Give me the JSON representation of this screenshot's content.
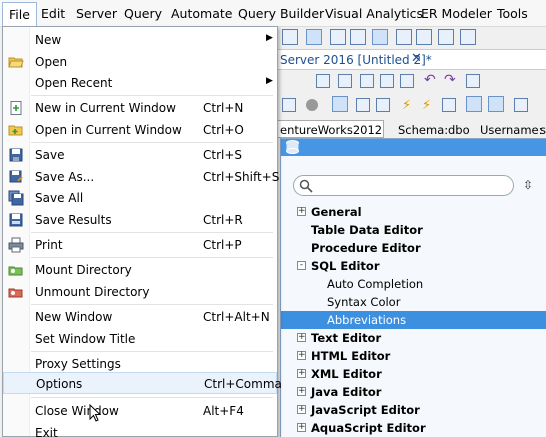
{
  "menubar": {
    "items": [
      "File",
      "Edit",
      "Server",
      "Query",
      "Automate",
      "Query Builder",
      "Visual Analytics",
      "ER Modeler",
      "Tools"
    ]
  },
  "background": {
    "doc_tab_title": "Server 2016 [Untitled 2]*",
    "db_selector": "entureWorks2012",
    "schema_label": "Schema:",
    "schema_value": "dbo",
    "username_label": "Username:",
    "username_value": "sa"
  },
  "file_menu": {
    "items": [
      {
        "label": "New",
        "shortcut": "",
        "submenu": true,
        "icon": "none"
      },
      {
        "label": "Open",
        "shortcut": "",
        "submenu": false,
        "icon": "folder-open-icon"
      },
      {
        "label": "Open Recent",
        "shortcut": "",
        "submenu": true,
        "icon": "none"
      },
      {
        "label": "New in Current Window",
        "shortcut": "Ctrl+N",
        "submenu": false,
        "icon": "new-document-icon"
      },
      {
        "label": "Open in Current Window",
        "shortcut": "Ctrl+O",
        "submenu": false,
        "icon": "open-document-icon"
      },
      {
        "label": "Save",
        "shortcut": "Ctrl+S",
        "submenu": false,
        "icon": "save-icon"
      },
      {
        "label": "Save As...",
        "shortcut": "Ctrl+Shift+S",
        "submenu": false,
        "icon": "save-as-icon"
      },
      {
        "label": "Save All",
        "shortcut": "",
        "submenu": false,
        "icon": "save-all-icon"
      },
      {
        "label": "Save Results",
        "shortcut": "Ctrl+R",
        "submenu": false,
        "icon": "save-results-icon"
      },
      {
        "label": "Print",
        "shortcut": "Ctrl+P",
        "submenu": false,
        "icon": "print-icon"
      },
      {
        "label": "Mount Directory",
        "shortcut": "",
        "submenu": false,
        "icon": "mount-directory-icon"
      },
      {
        "label": "Unmount Directory",
        "shortcut": "",
        "submenu": false,
        "icon": "unmount-directory-icon"
      },
      {
        "label": "New Window",
        "shortcut": "Ctrl+Alt+N",
        "submenu": false,
        "icon": "none"
      },
      {
        "label": "Set Window Title",
        "shortcut": "",
        "submenu": false,
        "icon": "none"
      },
      {
        "label": "Proxy Settings",
        "shortcut": "",
        "submenu": false,
        "icon": "none"
      },
      {
        "label": "Options",
        "shortcut": "Ctrl+Comma",
        "submenu": false,
        "icon": "none",
        "highlighted": true
      },
      {
        "label": "Close Window",
        "shortcut": "Alt+F4",
        "submenu": false,
        "icon": "none"
      },
      {
        "label": "Exit",
        "shortcut": "",
        "submenu": false,
        "icon": "none"
      }
    ]
  },
  "options_panel": {
    "search_placeholder": "",
    "tree": [
      {
        "label": "General",
        "bold": true,
        "toggle": "+",
        "indent": 0
      },
      {
        "label": "Table Data Editor",
        "bold": true,
        "toggle": "",
        "indent": 0
      },
      {
        "label": "Procedure Editor",
        "bold": true,
        "toggle": "",
        "indent": 0
      },
      {
        "label": "SQL Editor",
        "bold": true,
        "toggle": "-",
        "indent": 0
      },
      {
        "label": "Auto Completion",
        "bold": false,
        "toggle": "",
        "indent": 1
      },
      {
        "label": "Syntax Color",
        "bold": false,
        "toggle": "",
        "indent": 1
      },
      {
        "label": "Abbreviations",
        "bold": false,
        "toggle": "",
        "indent": 1,
        "selected": true
      },
      {
        "label": "Text Editor",
        "bold": true,
        "toggle": "+",
        "indent": 0
      },
      {
        "label": "HTML Editor",
        "bold": true,
        "toggle": "+",
        "indent": 0
      },
      {
        "label": "XML Editor",
        "bold": true,
        "toggle": "+",
        "indent": 0
      },
      {
        "label": "Java Editor",
        "bold": true,
        "toggle": "+",
        "indent": 0
      },
      {
        "label": "JavaScript Editor",
        "bold": true,
        "toggle": "+",
        "indent": 0
      },
      {
        "label": "AquaScript Editor",
        "bold": true,
        "toggle": "+",
        "indent": 0
      }
    ]
  },
  "colors": {
    "panel_header": "#4796e6",
    "tree_selection": "#3d8fe0",
    "menu_highlight": "#eaf2fc"
  }
}
